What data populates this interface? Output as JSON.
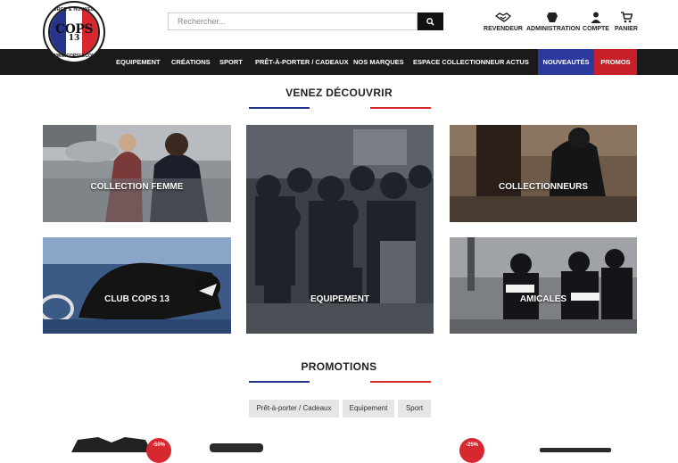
{
  "logo": {
    "top_text": "FORCE & HONNEUR",
    "name": "COPS",
    "number": "13",
    "bottom_text": "WWW.COPS13.COM"
  },
  "search": {
    "placeholder": "Rechercher..."
  },
  "header_tools": [
    {
      "label": "REVENDEUR",
      "icon": "handshake-icon"
    },
    {
      "label": "ADMINISTRATION",
      "icon": "admin-icon"
    },
    {
      "label": "COMPTE",
      "icon": "user-icon"
    },
    {
      "label": "PANIER",
      "icon": "cart-icon"
    }
  ],
  "nav": {
    "items": [
      "EQUIPEMENT",
      "CRÉATIONS",
      "SPORT",
      "PRÊT-À-PORTER / CADEAUX",
      "NOS MARQUES",
      "ESPACE COLLECTIONNEUR",
      "ACTUS"
    ],
    "new_label": "NOUVEAUTÉS",
    "promo_label": "PROMOS"
  },
  "discover": {
    "title": "VENEZ DÉCOUVRIR",
    "tiles": [
      "COLLECTION FEMME",
      "EQUIPEMENT",
      "COLLECTIONNEURS",
      "CLUB COPS 13",
      "AMICALES"
    ]
  },
  "promotions": {
    "title": "PROMOTIONS",
    "filters": [
      "Prêt-à-porter / Cadeaux",
      "Equipement",
      "Sport"
    ],
    "badges": [
      "-50%",
      "-25%"
    ]
  },
  "colors": {
    "blue": "#27348b",
    "red": "#d7272f",
    "nav_bg": "#1a1a1a"
  }
}
